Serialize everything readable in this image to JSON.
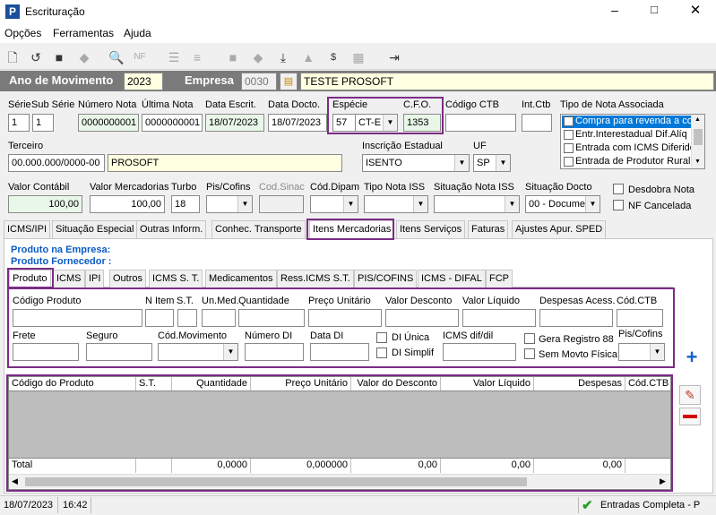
{
  "window": {
    "title": "Escrituração",
    "app_letter": "P"
  },
  "menu": [
    "Opções",
    "Ferramentas",
    "Ajuda"
  ],
  "header": {
    "ano_label": "Ano de Movimento",
    "ano_value": "2023",
    "empresa_label": "Empresa",
    "empresa_code": "0030",
    "empresa_name": "TESTE PROSOFT"
  },
  "row1": {
    "serie_label": "Série",
    "serie": "1",
    "subserie_label": "Sub Série",
    "subserie": "1",
    "numero_nota_label": "Número Nota",
    "numero_nota": "0000000001",
    "ultima_nota_label": "Última Nota",
    "ultima_nota": "0000000001",
    "data_escrit_label": "Data Escrit.",
    "data_escrit": "18/07/2023",
    "data_docto_label": "Data Docto.",
    "data_docto": "18/07/2023",
    "especie_label": "Espécie",
    "especie_code": "57",
    "especie": "CT-E",
    "cfo_label": "C.F.O.",
    "cfo": "1353",
    "codigo_ctb_label": "Código CTB",
    "int_ctb_label": "Int.Ctb",
    "tipo_nota_label": "Tipo de Nota Associada",
    "tipo_nota_options": [
      "Compra para revenda a co",
      "Entr.Interestadual Dif.Alíq",
      "Entrada com ICMS Diferido",
      "Entrada de Produtor Rural"
    ]
  },
  "row2": {
    "terceiro_label": "Terceiro",
    "terceiro_doc": "00.000.000/0000-00",
    "terceiro_nome": "PROSOFT",
    "ie_label": "Inscrição Estadual",
    "ie": "ISENTO",
    "uf_label": "UF",
    "uf": "SP"
  },
  "row3": {
    "valor_contabil_label": "Valor Contábil",
    "valor_contabil": "100,00",
    "valor_mercadorias_label": "Valor Mercadorias",
    "valor_mercadorias": "100,00",
    "turbo_label": "Turbo",
    "turbo": "18",
    "pis_cofins_label": "Pis/Cofins",
    "cod_sinac_label": "Cod.Sinac",
    "cod_dipam_label": "Cód.Dipam",
    "tipo_nota_iss_label": "Tipo Nota ISS",
    "situacao_nota_iss_label": "Situação Nota ISS",
    "situacao_docto_label": "Situação Docto",
    "situacao_docto": "00 - Documen",
    "desdobra_nota": "Desdobra Nota",
    "nf_cancelada": "NF Cancelada"
  },
  "main_tabs": [
    "ICMS/IPI",
    "Situação Especial",
    "Outras Inform.",
    "Conhec. Transporte",
    "Itens Mercadorias",
    "Itens Serviços",
    "Faturas",
    "Ajustes Apur. SPED"
  ],
  "produto_empresa": "Produto na Empresa:",
  "produto_fornecedor": "Produto Fornecedor :",
  "sub_tabs": [
    "Produto",
    "ICMS",
    "IPI",
    "Outros",
    "ICMS S. T.",
    "Medicamentos",
    "Ress.ICMS S.T.",
    "PIS/COFINS",
    "ICMS - DIFAL",
    "FCP"
  ],
  "produto_form": {
    "codigo_produto": "Código Produto",
    "n_item": "N Item",
    "st": "S.T.",
    "un_med": "Un.Med.",
    "quantidade": "Quantidade",
    "preco_unitario": "Preço Unitário",
    "valor_desconto": "Valor Desconto",
    "valor_liquido": "Valor Líquido",
    "despesas_acess": "Despesas Acess.",
    "cod_ctb": "Cód.CTB",
    "frete": "Frete",
    "seguro": "Seguro",
    "cod_movimento": "Cód.Movimento",
    "numero_di": "Número DI",
    "data_di": "Data DI",
    "di_unica": "DI Única",
    "di_simplif": "DI Simplif",
    "icms_dif_dil": "ICMS dif/dil",
    "gera_registro": "Gera Registro 88",
    "sem_movto_fisica": "Sem Movto Física",
    "pis_cofins": "Pis/Cofins"
  },
  "grid": {
    "columns": [
      "Código do Produto",
      "S.T.",
      "Quantidade",
      "Preço Unitário",
      "Valor do Desconto",
      "Valor Líquido",
      "Despesas",
      "Cód.CTB"
    ],
    "total_label": "Total",
    "totals": {
      "quantidade": "0,0000",
      "preco": "0,000000",
      "desconto": "0,00",
      "liquido": "0,00",
      "despesas": "0,00"
    }
  },
  "status": {
    "date": "18/07/2023",
    "time": "16:42",
    "mode": "Entradas Completa - P"
  },
  "colors": {
    "accent_purple": "#7b2c85",
    "header_bar": "#7a7a7a",
    "link_blue": "#0a5bc4"
  }
}
